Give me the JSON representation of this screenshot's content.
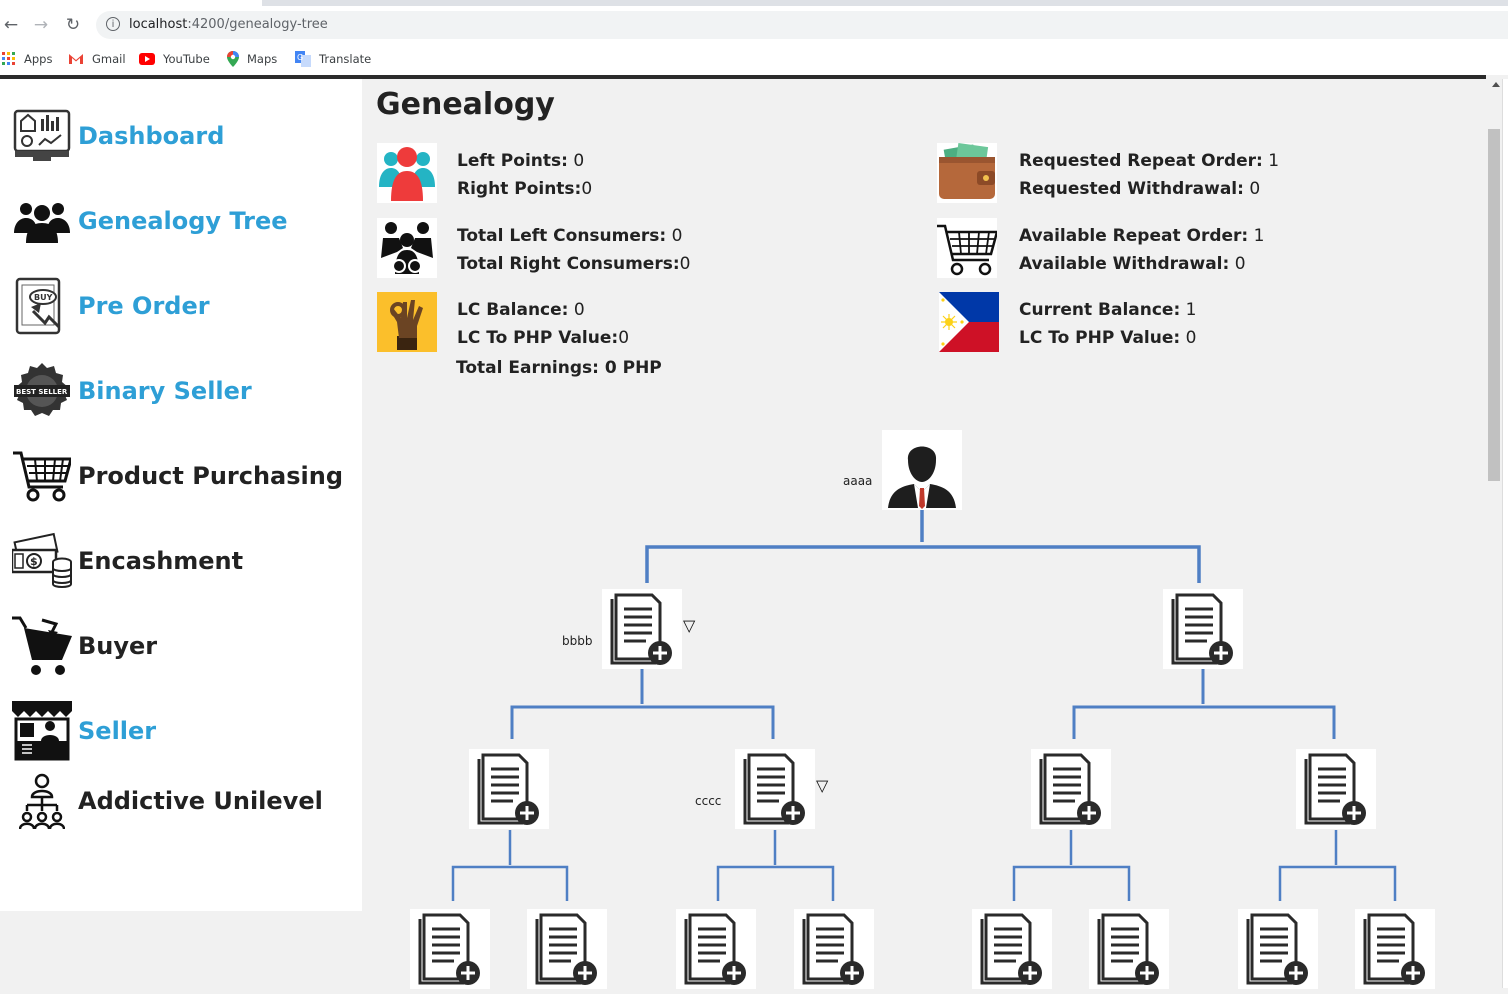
{
  "browser": {
    "url_host": "localhost",
    "url_path": ":4200/genealogy-tree",
    "bookmarks": [
      {
        "label": "Apps",
        "icon": "apps-grid-icon"
      },
      {
        "label": "Gmail",
        "icon": "gmail-icon"
      },
      {
        "label": "YouTube",
        "icon": "youtube-icon"
      },
      {
        "label": "Maps",
        "icon": "maps-pin-icon"
      },
      {
        "label": "Translate",
        "icon": "translate-icon"
      }
    ]
  },
  "colors": {
    "accent_blue": "#2e9fd6",
    "dark_text": "#222222",
    "tree_line": "#4f7fc4"
  },
  "sidebar": {
    "items": [
      {
        "label": "Dashboard",
        "icon": "dashboard-icon",
        "color": "blue"
      },
      {
        "label": "Genealogy Tree",
        "icon": "people-group-icon",
        "color": "blue"
      },
      {
        "label": "Pre Order",
        "icon": "buy-tablet-icon",
        "color": "blue"
      },
      {
        "label": "Binary Seller",
        "icon": "best-seller-badge-icon",
        "color": "blue"
      },
      {
        "label": "Product Purchasing",
        "icon": "shopping-cart-icon",
        "color": "dark"
      },
      {
        "label": "Encashment",
        "icon": "cash-coins-icon",
        "color": "dark"
      },
      {
        "label": "Buyer",
        "icon": "buyer-cart-icon",
        "color": "dark"
      },
      {
        "label": "Seller",
        "icon": "seller-stall-icon",
        "color": "blue"
      },
      {
        "label": "Addictive Unilevel",
        "icon": "hierarchy-icon",
        "color": "dark"
      }
    ]
  },
  "page": {
    "title": "Genealogy"
  },
  "stats": {
    "left_points_label": "Left Points:",
    "left_points_value": " 0",
    "right_points_label": "Right Points:",
    "right_points_value": "0",
    "total_left_consumers_label": "Total Left Consumers:",
    "total_left_consumers_value": " 0",
    "total_right_consumers_label": "Total Right Consumers:",
    "total_right_consumers_value": "0",
    "lc_balance_label": "LC Balance:",
    "lc_balance_value": " 0",
    "lc_to_php_left_label": "LC To PHP Value:",
    "lc_to_php_left_value": "0",
    "total_earnings": "Total Earnings: 0 PHP",
    "requested_repeat_order_label": "Requested Repeat Order:",
    "requested_repeat_order_value": " 1",
    "requested_withdrawal_label": "Requested Withdrawal:",
    "requested_withdrawal_value": " 0",
    "available_repeat_order_label": "Available Repeat Order:",
    "available_repeat_order_value": " 1",
    "available_withdrawal_label": "Available Withdrawal:",
    "available_withdrawal_value": " 0",
    "current_balance_label": "Current Balance:",
    "current_balance_value": " 1",
    "lc_to_php_right_label": "LC To PHP Value:",
    "lc_to_php_right_value": " 0"
  },
  "tree": {
    "root": {
      "label": "aaaa",
      "icon": "person-avatar-icon"
    },
    "level1": [
      {
        "label": "bbbb",
        "icon": "add-document-icon",
        "expand": "▽"
      },
      {
        "label": "",
        "icon": "add-document-icon"
      }
    ],
    "level2": [
      {
        "label": "",
        "icon": "add-document-icon"
      },
      {
        "label": "cccc",
        "icon": "add-document-icon",
        "expand": "▽"
      },
      {
        "label": "",
        "icon": "add-document-icon"
      },
      {
        "label": "",
        "icon": "add-document-icon"
      }
    ],
    "level3_count_label": "8"
  }
}
